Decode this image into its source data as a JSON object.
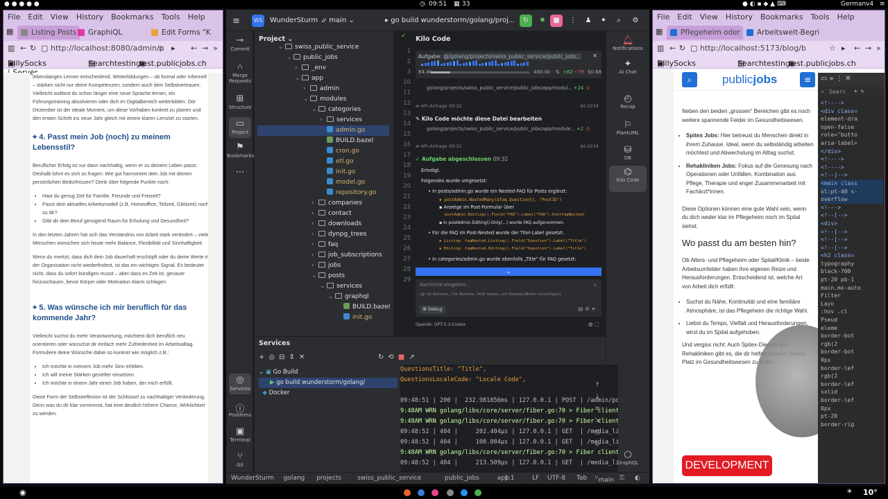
{
  "topbar": {
    "time": "09:51",
    "workspace": "33",
    "keyboard": "German",
    "battery_label": "v4"
  },
  "left_browser": {
    "menu": [
      "File",
      "Edit",
      "View",
      "History",
      "Bookmarks",
      "Tools",
      "Help"
    ],
    "tabs": [
      "Listing Posts - S",
      "GraphiQL",
      "Edit Forms \"K"
    ],
    "url": "http://localhost:8080/admin/p",
    "bookmarks": [
      "DillySocks | Server",
      "Searchtesting",
      "test.publicjobs.ch"
    ],
    "page": {
      "p1": "lebenslanges Lernen entscheidend. Weiterbildungen – ob formal oder informell – stärken nicht nur deine Kompetenzen, sondern auch dein Selbstvertrauen. Vielleicht wolltest du schon länger eine neue Sprache lernen, ein Führungstraining absolvieren oder dich im Digitalbereich weiterbilden. Der Dezember ist der ideale Moment, um diese Vorhaben konkret zu planen und den ersten Schritt ins neue Jahr gleich mit einem klaren Lernziel zu starten.",
      "h4": "4. Passt mein Job (noch) zu meinem Lebensstil?",
      "p2": "Beruflicher Erfolg ist nur dann nachhaltig, wenn er zu deinem Leben passt. Deshalb lohnt es sich zu fragen: Wie gut harmoniert dein Job mit deinen persönlichen Bedürfnissen? Denk über folgende Punkte nach:",
      "list1": [
        "Hast du genug Zeit für Familie, Freunde und Freizeit?",
        "Passt dein aktuelles Arbeitsmodell (z.B. Homeoffice, Teilzeit, Gleitzeit) noch zu dir?",
        "Gibt dir dein Beruf genügend Raum für Erholung und Gesundheit?"
      ],
      "p3": "In den letzten Jahren hat sich das Verständnis von Arbeit stark verändert – viele Menschen wünschen sich heute mehr Balance, Flexibilität und Sinnhaftigkeit.",
      "p4": "Wenn du merkst, dass dich dein Job dauerhaft erschöpft oder du deine Werte in der Organisation nicht wiederfindest, ist das ein wichtiges Signal. Es bedeutet nicht, dass du sofort kündigen musst – aber dass es Zeit ist, genauer hinzuschauen, bevor Körper oder Motivation Alarm schlagen.",
      "h5": "5. Was wünsche ich mir beruflich für das kommende Jahr?",
      "p5": "Vielleicht suchst du mehr Verantwortung, möchtest dich beruflich neu orientieren oder wünschst dir einfach mehr Zufriedenheit im Arbeitsalltag. Formuliere deine Wünsche dabei so konkret wie möglich z.B.:",
      "list2": [
        "Ich möchte in meinem Job mehr Sinn erleben.",
        "Ich will meine Stärken gezielter einsetzen.",
        "Ich möchte in einem Jahr einen Job haben, der mich erfüllt."
      ],
      "p6": "Diese Form der Selbstreflexion ist der Schlüssel zu nachhaltiger Veränderung. Denn was du dir klar vornimmst, hat eine deutlich höhere Chance, Wirklichkeit zu werden."
    }
  },
  "ide": {
    "project_name": "WunderSturm",
    "branch": "main",
    "run_config": "go build wunderstorm/golang/proj...lic_jobs",
    "sidebar": [
      "Commit",
      "Merge Requests",
      "Structure",
      "Project",
      "Bookmarks",
      "Services",
      "Problems",
      "Terminal",
      "Git"
    ],
    "project_title": "Project",
    "tree": [
      {
        "label": "swiss_public_service",
        "depth": 3,
        "kind": "folder",
        "open": true
      },
      {
        "label": "public_jobs",
        "depth": 4,
        "kind": "folder",
        "open": true
      },
      {
        "label": "_env",
        "depth": 5,
        "kind": "folder",
        "open": false
      },
      {
        "label": "app",
        "depth": 5,
        "kind": "folder",
        "open": true
      },
      {
        "label": "admin",
        "depth": 6,
        "kind": "folder",
        "open": false
      },
      {
        "label": "modules",
        "depth": 6,
        "kind": "folder",
        "open": true
      },
      {
        "label": "categories",
        "depth": 7,
        "kind": "folder",
        "open": true
      },
      {
        "label": "services",
        "depth": 8,
        "kind": "folder",
        "open": false
      },
      {
        "label": "admin.go",
        "depth": 8,
        "kind": "go",
        "selected": true
      },
      {
        "label": "BUILD.bazel",
        "depth": 8,
        "kind": "bazel"
      },
      {
        "label": "cron.go",
        "depth": 8,
        "kind": "go"
      },
      {
        "label": "etl.go",
        "depth": 8,
        "kind": "go"
      },
      {
        "label": "init.go",
        "depth": 8,
        "kind": "go"
      },
      {
        "label": "model.go",
        "depth": 8,
        "kind": "go"
      },
      {
        "label": "repository.go",
        "depth": 8,
        "kind": "go"
      },
      {
        "label": "companies",
        "depth": 7,
        "kind": "folder",
        "open": false
      },
      {
        "label": "contact",
        "depth": 7,
        "kind": "folder",
        "open": false
      },
      {
        "label": "downloads",
        "depth": 7,
        "kind": "folder",
        "open": false
      },
      {
        "label": "dynpg_trees",
        "depth": 7,
        "kind": "folder",
        "open": false
      },
      {
        "label": "faq",
        "depth": 7,
        "kind": "folder",
        "open": false
      },
      {
        "label": "job_subscriptions",
        "depth": 7,
        "kind": "folder",
        "open": false
      },
      {
        "label": "jobs",
        "depth": 7,
        "kind": "folder",
        "open": false
      },
      {
        "label": "posts",
        "depth": 7,
        "kind": "folder",
        "open": true
      },
      {
        "label": "services",
        "depth": 8,
        "kind": "folder",
        "open": true
      },
      {
        "label": "graphql",
        "depth": 9,
        "kind": "folder",
        "open": true
      },
      {
        "label": "BUILD.bazel",
        "depth": 10,
        "kind": "bazel"
      },
      {
        "label": "init.go",
        "depth": 10,
        "kind": "go"
      }
    ],
    "line_numbers": [
      "1",
      "2",
      "3",
      "10",
      "11",
      "12",
      "13",
      "14",
      "15",
      "16",
      "17",
      "18",
      "19",
      "20",
      "21",
      "22",
      "23",
      "24",
      "25",
      "26",
      "27",
      "28",
      "29"
    ],
    "kilo": {
      "title": "Kilo Code",
      "task_label": "Aufgabe:",
      "task_path": "@/golang/projects/swiss_public_service/public_jobs...",
      "tokens": "84.4k",
      "context": "400.0k",
      "diff_add": "+82",
      "diff_del": "−79",
      "cost": "$0.68",
      "file1": "golang/projects/swiss_public_service/public_jobs/app/modul...",
      "file1_add": "+24",
      "file1_del": "-1",
      "api1": "API-Anfrage",
      "api1_time": "09:32",
      "api1_cost": "$0.0234",
      "edit_title": "Kilo Code möchte diese Datei bearbeiten",
      "file2": "golang/projects/swiss_public_service/public_jobs/app/module...",
      "file2_add": "+2",
      "file2_del": "-1",
      "api2": "API-Anfrage",
      "api2_time": "09:32",
      "api2_cost": "$0.0234",
      "done_title": "Aufgabe abgeschlossen",
      "done_time": "09:32",
      "done_text": "Erledigt.",
      "summary": "Folgendes wurde umgesetzt:",
      "b1": "In posts/admin.go wurde ein Nested-FAQ für Posts ergänzt:",
      "b1a": "postAdmin.NestedMany(&faq.Question{}, \"PostID\")",
      "b1b": "Anzeige im Post-Formular über",
      "b1b2": "postAdmin.Editing().Field(\"FAQ\").Label(\"FAQ\").Use(faqNested)",
      "b1c": "In postAdmin.Editing().Only(...) wurde FAQ aufgenommen.",
      "b2": "Für die FAQ im Post-Nested wurde der Titel-Label gesetzt:",
      "b2a": "Listing: faqNested.Listing().Field(\"Question\").Label(\"Title\")",
      "b2b": "Editing: faqNested.Editing().Field(\"Question\").Label(\"Title\")",
      "b3": "In categories/admin.go wurde ebenfalls „Title“ für FAQ gesetzt:",
      "input_placeholder": "Nachricht eingeben...",
      "input_hint": "(@ für Kontext, / für Befehle, Shift halten, um Dateien/Bilder einzufügen)",
      "mode": "Debug",
      "model": "OpenAI: GPT-5.3-Codex"
    },
    "right_sidebar": [
      "Notifications",
      "AI Chat",
      "Recap",
      "PlantUML",
      "DB",
      "Kilo Code",
      "GraphQL"
    ],
    "services": {
      "title": "Services",
      "tree": [
        "Go Build",
        "go build wunderstorm/golang/",
        "Docker"
      ],
      "console": [
        "QuestionsTitle: \"Title\",",
        "QuestionsLocaleCode: \"Locale Code\",",
        "",
        "09:48:51 | 200 |  232.981856ms | 127.0.0.1 | POST | /admin/po",
        "9:48AM WRN golang/libs/core/server/fiber.go:70 > Fiber client",
        "9:48AM WRN golang/libs/core/server/fiber.go:70 > Fiber client",
        "09:48:52 | 404 |     202.404µs | 127.0.0.1 | GET  | /media_li",
        "09:48:52 | 404 |     108.084µs | 127.0.0.1 | GET  | /media_li",
        "9:48AM WRN golang/libs/core/server/fiber.go:70 > Fiber client",
        "09:48:52 | 404 |     213.509µs | 127.0.0.1 | GET  | /media_li"
      ]
    },
    "statusbar": {
      "path": [
        "WunderSturm",
        "golang",
        "projects",
        "swiss_public_service",
        "public_jobs",
        "app"
      ],
      "pos": "1:1",
      "lf": "LF",
      "enc": "UTF-8",
      "indent": "Tab",
      "branch": "main"
    }
  },
  "right_browser": {
    "menu": [
      "File",
      "Edit",
      "View",
      "History",
      "Bookmarks",
      "Tools",
      "Help"
    ],
    "tabs": [
      "Pflegeheim oder",
      "Arbeitswelt-Begri"
    ],
    "url": "http://localhost:5173/blog/b",
    "bookmarks": [
      "DillySocks | Server",
      "Searchtesting",
      "test.publicjobs.ch"
    ],
    "logo_left": "public",
    "logo_right": "jobs",
    "page": {
      "p1": "Neben den beiden „grossen“ Bereichen gibt es noch weitere spannende Felder im Gesundheitswesen.",
      "li1_bold": "Spitex Jobs:",
      "li1": " Hier betreust du Menschen direkt in ihrem Zuhause. Ideal, wenn du selbständig arbeiten möchtest und Abwechslung im Alltag suchst.",
      "li2_bold": "Rehakliniken Jobs:",
      "li2": " Fokus auf die Genesung nach Operationen oder Unfällen. Kombination aus Pflege, Therapie und enger Zusammenarbeit mit Fachärzt*innen.",
      "p2": "Diese Optionen können eine gute Wahl sein, wenn du dich weder klar im Pflegeheim noch im Spital siehst.",
      "h": "Wo passt du am besten hin?",
      "p3": "Ob Alters- und Pflegeheim oder Spital/Klinik – beide Arbeitsumfelder haben ihre eigenen Reize und Herausforderungen. Entscheidend ist, welche Art von Arbeit dich erfüllt:",
      "li3": "Suchst du Nähe, Kontinuität und eine familiäre Atmosphäre, ist das Pflegeheim die richtige Wahl.",
      "li4": "Liebst du Tempo, Vielfalt und Herausforderungen, wirst du im Spital aufgehoben.",
      "p4": "Und vergiss nicht: Auch Spitex-Dienste und Rehakliniken gibt es, die dir helfen können, deinen Platz im Gesundheitswesen zu finden.",
      "badge": "DEVELOPMENT"
    },
    "devtools": {
      "search": "Searc",
      "lines": [
        "<!---->",
        "<div class=",
        "element-dra",
        "open-false",
        "role=\"butto",
        "aria-label=",
        "</div>",
        "<!---->",
        "<!---->",
        "<!--]-->",
        "<main class",
        "xl:pt-40 s-",
        "overflow",
        "<!--->",
        "<!--[-->",
        "<div>",
        "<!--[-->",
        "<!--[-->",
        "<!--[-->",
        "<h2 class=",
        "typography",
        "black-700",
        "pt-20 pb-1",
        "main.mx-auto",
        "Filter",
        "Layo",
        ":hov .cl",
        "Pseud",
        "eleme",
        "border-bot",
        "rgb(2",
        "border-bot",
        "0px",
        "border-lef",
        "rgb(2",
        "border-lef",
        "solid",
        "border-lef",
        "0px",
        "pt-20",
        "border-rig"
      ]
    }
  }
}
